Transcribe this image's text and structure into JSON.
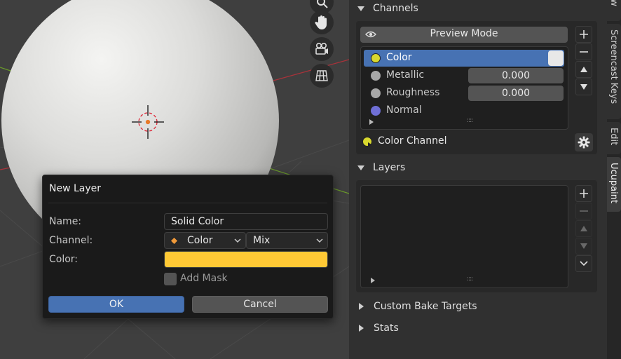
{
  "dialog": {
    "title": "New Layer",
    "name_label": "Name:",
    "name_value": "Solid Color",
    "channel_label": "Channel:",
    "channel_value": "Color",
    "blend_value": "Mix",
    "color_label": "Color:",
    "color_value": "#ffc935",
    "add_mask_label": "Add Mask",
    "add_mask_checked": false,
    "ok_label": "OK",
    "cancel_label": "Cancel"
  },
  "channels": {
    "header": "Channels",
    "preview_mode_label": "Preview Mode",
    "items": [
      {
        "label": "Color",
        "selected": true,
        "swatch": "#e8e8e8",
        "dot": "#d8d82e"
      },
      {
        "label": "Metallic",
        "value": "0.000",
        "dot": "#a8a8a8"
      },
      {
        "label": "Roughness",
        "value": "0.000",
        "dot": "#a8a8a8"
      },
      {
        "label": "Normal",
        "dot": "#6f6fd6"
      }
    ],
    "active_channel_label": "Color Channel"
  },
  "layers": {
    "header": "Layers"
  },
  "collapsed_sections": {
    "custom_bake_targets": "Custom Bake Targets",
    "stats": "Stats"
  },
  "tabs": {
    "view": "View",
    "screencast_keys": "Screencast Keys",
    "edit": "Edit",
    "ucupaint": "Ucupaint"
  },
  "colors": {
    "accent_blue": "#4772b3",
    "dialog_bg": "#1a1a1a",
    "panel_bg": "#303030"
  }
}
